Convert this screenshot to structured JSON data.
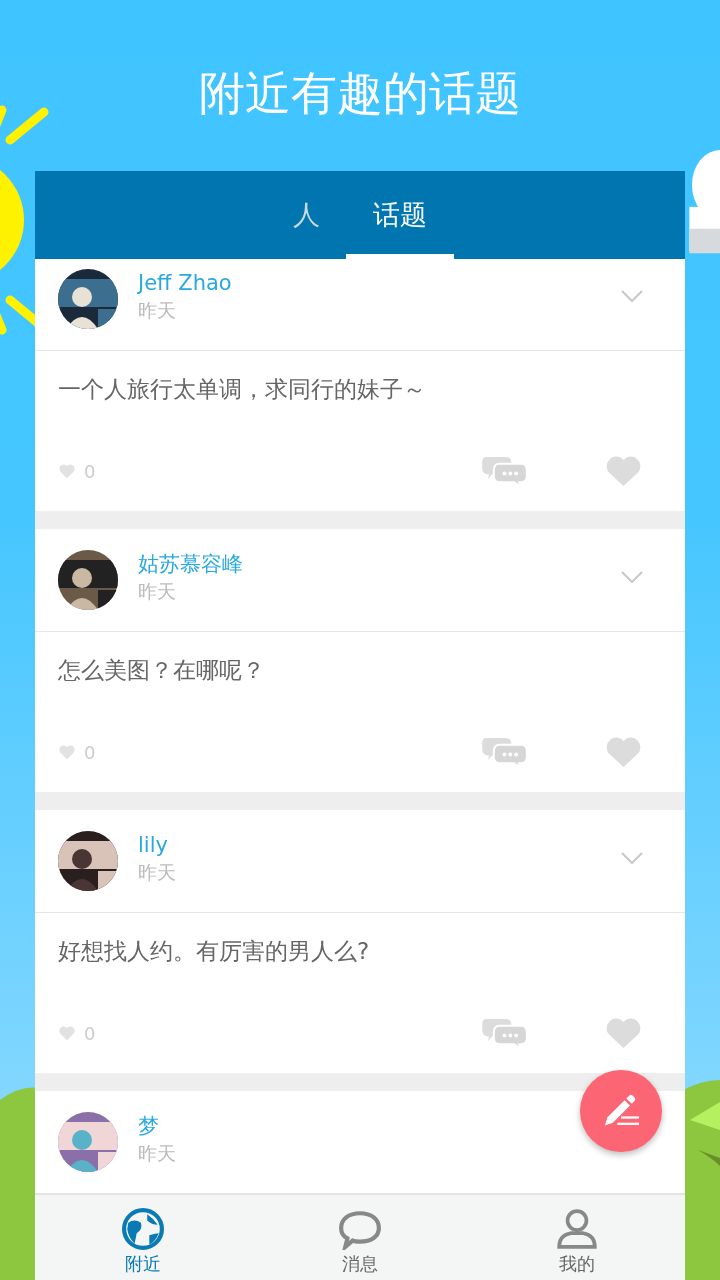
{
  "header": {
    "title": "附近有趣的话题"
  },
  "tabs": [
    {
      "label": "人",
      "selected": false
    },
    {
      "label": "话题",
      "selected": true
    }
  ],
  "posts": [
    {
      "name": "Jeff Zhao",
      "time": "昨天",
      "text": "一个人旅行太单调，求同行的妹子～",
      "likes": "0"
    },
    {
      "name": "姑苏慕容峰",
      "time": "昨天",
      "text": "怎么美图？在哪呢？",
      "likes": "0"
    },
    {
      "name": "lily",
      "time": "昨天",
      "text": "好想找人约。有厉害的男人么?",
      "likes": "0"
    },
    {
      "name": "梦",
      "time": "昨天"
    }
  ],
  "nav": [
    {
      "label": "附近",
      "kind": "globe",
      "selected": true
    },
    {
      "label": "消息",
      "kind": "chat",
      "selected": false
    },
    {
      "label": "我的",
      "kind": "person",
      "selected": false
    }
  ]
}
